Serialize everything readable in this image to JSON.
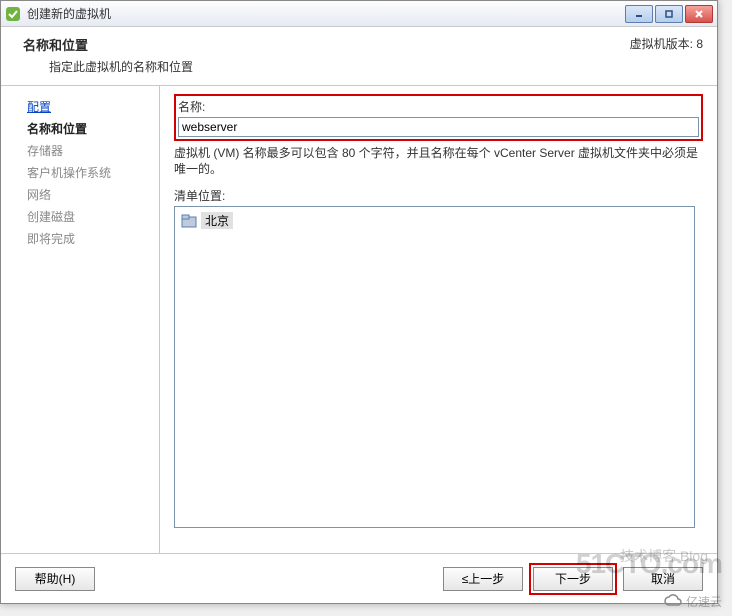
{
  "window": {
    "title": "创建新的虚拟机"
  },
  "header": {
    "title": "名称和位置",
    "subtitle": "指定此虚拟机的名称和位置",
    "version": "虚拟机版本: 8"
  },
  "sidebar": {
    "steps": [
      {
        "label": "配置",
        "state": "link"
      },
      {
        "label": "名称和位置",
        "state": "current"
      },
      {
        "label": "存储器",
        "state": "future"
      },
      {
        "label": "客户机操作系统",
        "state": "future"
      },
      {
        "label": "网络",
        "state": "future"
      },
      {
        "label": "创建磁盘",
        "state": "future"
      },
      {
        "label": "即将完成",
        "state": "future"
      }
    ]
  },
  "main": {
    "name_label": "名称:",
    "name_value": "webserver",
    "hint": "虚拟机 (VM) 名称最多可以包含 80 个字符，并且名称在每个 vCenter Server 虚拟机文件夹中必须是唯一的。",
    "inventory_label": "清单位置:",
    "tree_root": "北京"
  },
  "footer": {
    "help": "帮助(H)",
    "back": "≤上一步",
    "next": "下一步",
    "cancel": "取消"
  },
  "watermarks": {
    "w1": "51CTO.com",
    "w2": "亿速云",
    "w3": "技术博客 Blog"
  }
}
